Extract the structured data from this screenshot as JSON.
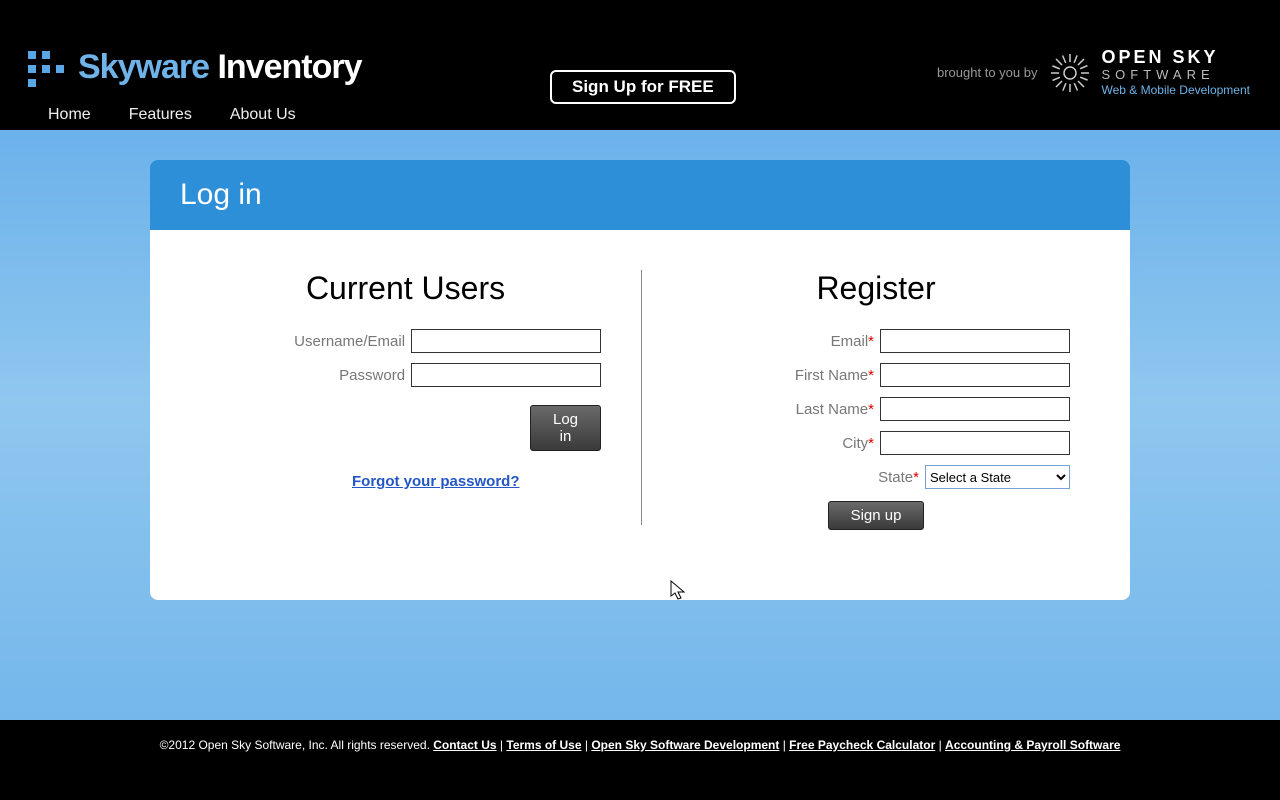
{
  "header": {
    "brand": "Skyware",
    "product": "Inventory",
    "signup_button": "Sign Up for FREE",
    "brought_by": "brought to you by",
    "sponsor_line1": "OPEN SKY",
    "sponsor_line2": "SOFTWARE",
    "sponsor_line3": "Web & Mobile Development"
  },
  "nav": {
    "home": "Home",
    "features": "Features",
    "about": "About Us"
  },
  "panel": {
    "title": "Log in"
  },
  "login": {
    "heading": "Current Users",
    "username_label": "Username/Email",
    "username_value": "",
    "password_label": "Password",
    "password_value": "",
    "button": "Log in",
    "forgot": "Forgot your password?"
  },
  "register": {
    "heading": "Register",
    "email_label": "Email",
    "email_value": "",
    "firstname_label": "First Name",
    "firstname_value": "",
    "lastname_label": "Last Name",
    "lastname_value": "",
    "city_label": "City",
    "city_value": "",
    "state_label": "State",
    "state_selected": "Select a State",
    "button": "Sign up"
  },
  "footer": {
    "copyright": "©2012 Open Sky Software, Inc. All rights reserved. ",
    "links": {
      "contact": "Contact Us",
      "terms": "Terms of Use",
      "opensky": "Open Sky Software Development",
      "paycheck": "Free Paycheck Calculator",
      "accounting": "Accounting & Payroll Software"
    },
    "sep": " | "
  }
}
